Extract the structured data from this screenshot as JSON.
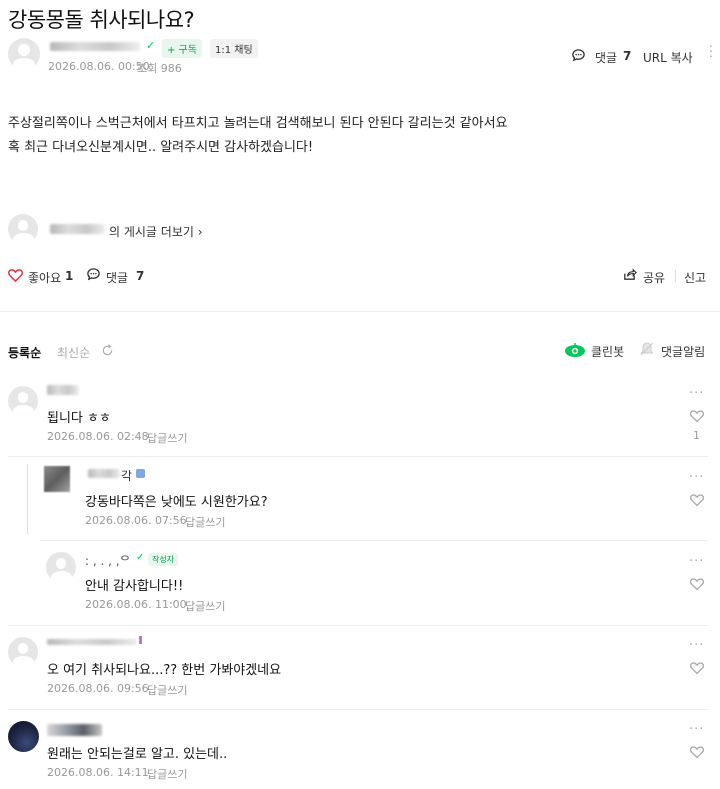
{
  "post": {
    "title": "강동몽돌 취사되나요?",
    "subscribe": "+ 구독",
    "chat": "1:1 채팅",
    "date": "2026.08.06. 00:50",
    "views": "조회 986",
    "comment_label": "댓글",
    "comment_count": "7",
    "url_copy": "URL 복사",
    "body_lines": [
      "주상절리쪽이나 스벅근처에서 타프치고 놀려는대 검색해보니 된다 안된다 갈리는것 같아서요",
      "혹 최근 다녀오신분계시면.. 알려주시면 감사하겠습니다!"
    ],
    "more_posts": "의 게시글 더보기 ›",
    "like_label": "좋아요",
    "like_count": "1",
    "comment_label2": "댓글",
    "comment_count2": "7",
    "share": "공유",
    "report": "신고"
  },
  "sort": {
    "registered": "등록순",
    "latest": "최신순",
    "cleanbot": "클린봇",
    "comment_alarm": "댓글알림"
  },
  "comments": [
    {
      "text": "됩니다 ㅎㅎ",
      "date": "2026.08.06. 02:48",
      "reply": "답글쓰기",
      "likes": "1"
    },
    {
      "name_suffix": "각",
      "text": "강동바다쪽은 낮에도 시원한가요?",
      "date": "2026.08.06. 07:56",
      "reply": "답글쓰기"
    },
    {
      "name_prefix": ": ,  . , ,ᄋ",
      "writer_badge": "작성자",
      "text": "안내 감사합니다!!",
      "date": "2026.08.06. 11:00",
      "reply": "답글쓰기"
    },
    {
      "text": "오 여기 취사되나요...?? 한번 가봐야겠네요",
      "date": "2026.08.06. 09:56",
      "reply": "답글쓰기"
    },
    {
      "text": "원래는 안되는걸로 알고. 있는데..",
      "date": "2026.08.06. 14:11",
      "reply": "답글쓰기"
    }
  ],
  "icons": {
    "like": "heart-icon",
    "comment": "speech-bubble-icon",
    "share": "share-icon",
    "refresh": "refresh-icon",
    "cleanbot": "cleanbot-icon",
    "bell": "bell-icon",
    "more": "more-dots-icon"
  },
  "colors": {
    "like_red": "#e5383b",
    "cleanbot_green": "#03c75a",
    "writer_badge_green": "#03c75a"
  }
}
